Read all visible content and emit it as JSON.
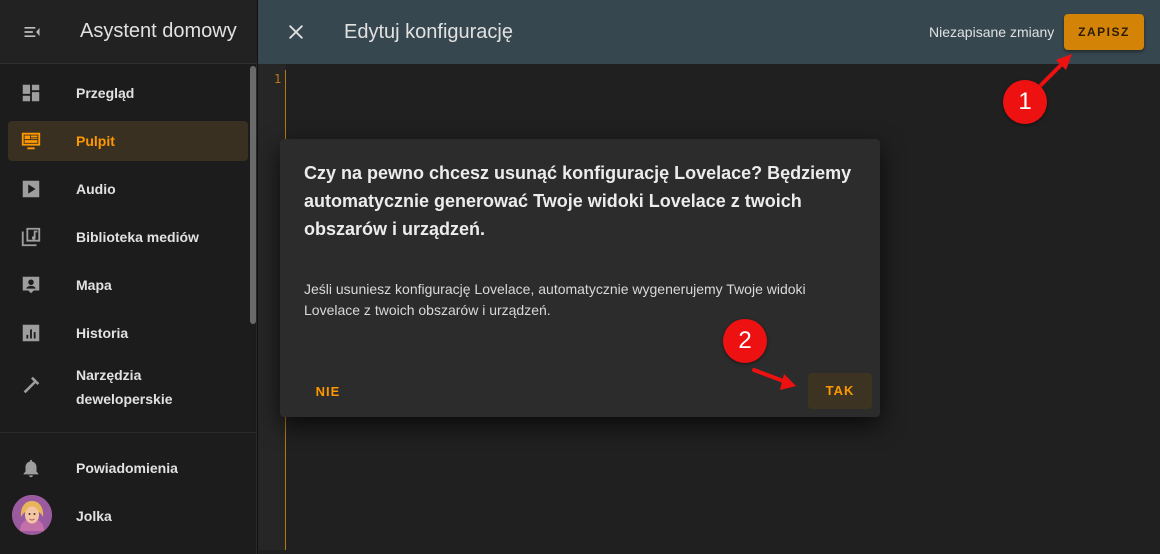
{
  "sidebar": {
    "title": "Asystent domowy",
    "items": [
      {
        "label": "Przegląd",
        "icon": "dashboard-icon"
      },
      {
        "label": "Pulpit",
        "icon": "monitor-dashboard-icon",
        "active": true
      },
      {
        "label": "Audio",
        "icon": "play-box-icon"
      },
      {
        "label": "Biblioteka mediów",
        "icon": "music-library-icon"
      },
      {
        "label": "Mapa",
        "icon": "account-box-icon"
      },
      {
        "label": "Historia",
        "icon": "chart-box-icon"
      },
      {
        "label": "Narzędzia\ndeweloperskie",
        "icon": "hammer-icon"
      }
    ],
    "notifications": {
      "label": "Powiadomienia",
      "icon": "bell-icon"
    },
    "user": {
      "label": "Jolka"
    }
  },
  "topbar": {
    "title": "Edytuj konfigurację",
    "unsaved_label": "Niezapisane zmiany",
    "save_label": "ZAPISZ"
  },
  "editor": {
    "line_numbers": [
      "1"
    ]
  },
  "dialog": {
    "title": "Czy na pewno chcesz usunąć konfigurację Lovelace? Będziemy automatycznie generować Twoje widoki Lovelace z twoich obszarów i urządzeń.",
    "text": "Jeśli usuniesz konfigurację Lovelace, automatycznie wygenerujemy Twoje widoki Lovelace z twoich obszarów i urządzeń.",
    "cancel_label": "NIE",
    "confirm_label": "TAK"
  },
  "annotations": {
    "step1": "1",
    "step2": "2"
  },
  "colors": {
    "accent": "#ff9800",
    "save_button": "#d38306",
    "topbar": "#37474f",
    "badge": "#ee1111"
  }
}
